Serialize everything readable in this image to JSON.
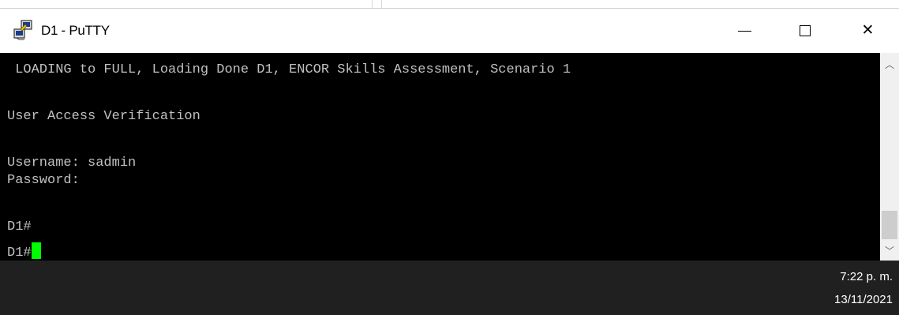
{
  "window": {
    "title": "D1 - PuTTY",
    "icons": {
      "app": "putty-icon",
      "minimize": "minimize-icon",
      "maximize": "maximize-icon",
      "close": "close-icon"
    },
    "close_glyph": "✕"
  },
  "terminal": {
    "background": "#000000",
    "text_color": "#c0c0c0",
    "cursor_color": "#00ff00",
    "lines": [
      " LOADING to FULL, Loading Done D1, ENCOR Skills Assessment, Scenario 1",
      "",
      "User Access Verification",
      "",
      "Username: sadmin",
      "Password:",
      "",
      "D1#",
      "D1#"
    ]
  },
  "scrollbar": {
    "up_icon": "chevron-up-icon",
    "down_icon": "chevron-down-icon",
    "up_glyph": "︿",
    "down_glyph": "﹀"
  },
  "taskbar": {
    "time": "7:22 p. m.",
    "date": "13/11/2021"
  }
}
